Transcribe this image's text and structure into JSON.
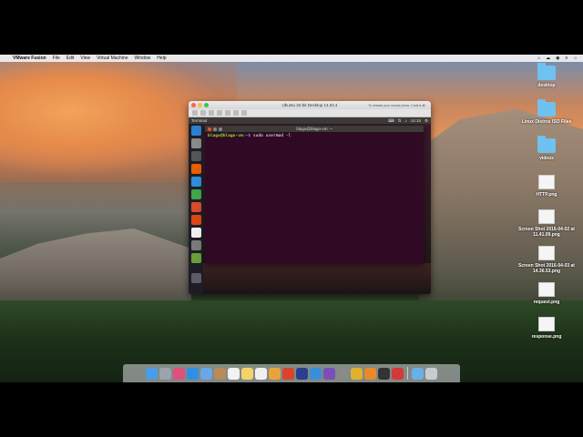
{
  "menubar": {
    "apple_icon": "apple-icon",
    "items": [
      "VMware Fusion",
      "File",
      "Edit",
      "View",
      "Virtual Machine",
      "Window",
      "Help"
    ],
    "status": [
      "⌂",
      "☁",
      "◉",
      "≡",
      "☼"
    ]
  },
  "desktop_icons": [
    {
      "label": "desktop",
      "kind": "folder"
    },
    {
      "label": "Linux Distros ISO Files",
      "kind": "folder"
    },
    {
      "label": "videos",
      "kind": "folder"
    },
    {
      "label": "HTTP.png",
      "kind": "file"
    },
    {
      "label": "Screen Shot 2016-04-02 at 11.41.09.png",
      "kind": "file"
    },
    {
      "label": "Screen Shot 2016-04-03 at 14.36.53.png",
      "kind": "file"
    },
    {
      "label": "request.png",
      "kind": "file"
    },
    {
      "label": "response.png",
      "kind": "file"
    }
  ],
  "vm_window": {
    "title": "Ubuntu 32-bit Desktop 14.04.4",
    "release_hint": "To release your mouse press: Control-⌘",
    "guest": {
      "panel_app": "Terminal",
      "panel_clock": "14:15",
      "terminal": {
        "title": "blago@blago-vm: ~",
        "prompt_user": "blago@blago-vm",
        "prompt_path": ":~$",
        "command": " sudo usermod -l"
      }
    }
  },
  "dock": {
    "items": [
      "finder",
      "launchpad",
      "itunes",
      "safari",
      "mail",
      "contacts",
      "calendar",
      "notes",
      "reminders",
      "photos",
      "messages",
      "facetime",
      "maps",
      "app-store",
      "system-preferences",
      "chrome",
      "vmware",
      "terminal",
      "firefox",
      "downloads",
      "trash"
    ]
  }
}
